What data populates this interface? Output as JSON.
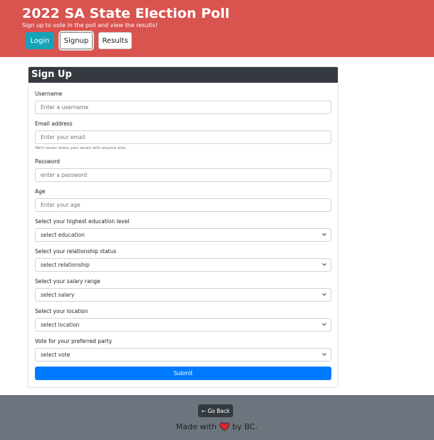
{
  "header": {
    "title": "2022 SA State Election Poll",
    "subtitle": "Sign up to vote in the poll and view the results!",
    "nav": {
      "login": "Login",
      "signup": "Signup",
      "results": "Results"
    }
  },
  "form": {
    "title": "Sign Up",
    "username": {
      "label": "Username",
      "placeholder": "Enter a username"
    },
    "email": {
      "label": "Email address",
      "placeholder": "Enter your email",
      "help": "We'll never share your email with anyone else."
    },
    "password": {
      "label": "Password",
      "placeholder": "enter a password"
    },
    "age": {
      "label": "Age",
      "placeholder": "Enter your age"
    },
    "education": {
      "label": "Select your highest education level",
      "selected": "select education"
    },
    "relationship": {
      "label": "Select your relationship status",
      "selected": "select relationship"
    },
    "salary": {
      "label": "Select your salary range",
      "selected": "select salary"
    },
    "location": {
      "label": "Select your location",
      "selected": "select location"
    },
    "vote": {
      "label": "Vote for your preferred party",
      "selected": "select vote"
    },
    "submit": "Submit"
  },
  "footer": {
    "go_back": "← Go Back",
    "made_with": "Made with",
    "by": "by BC.",
    "heart_icon": "heart-icon",
    "heart_color": "#e0242e"
  },
  "colors": {
    "header_bg": "#d9534f",
    "login_bg": "#17a2b8",
    "card_header_bg": "#343a40",
    "submit_bg": "#007bff",
    "footer_bg": "#6c757d"
  }
}
